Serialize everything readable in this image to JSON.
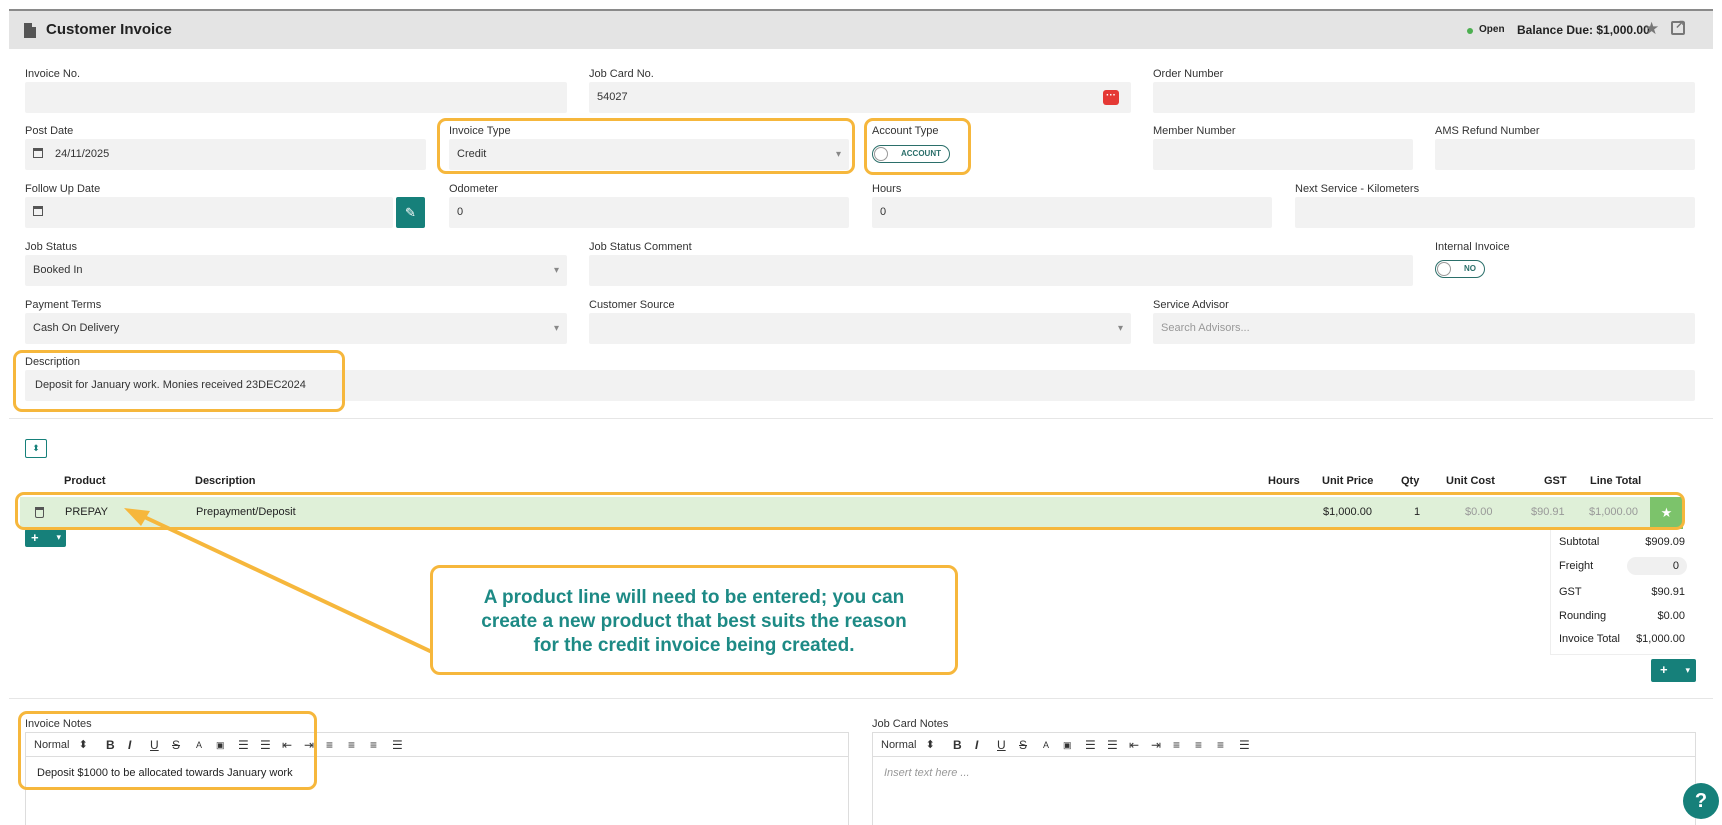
{
  "header": {
    "title": "Customer Invoice",
    "status": "Open",
    "balance": "Balance Due: $1,000.00"
  },
  "form": {
    "invoice_no": {
      "label": "Invoice No.",
      "value": ""
    },
    "job_card_no": {
      "label": "Job Card No.",
      "value": "54027"
    },
    "order_number": {
      "label": "Order Number",
      "value": ""
    },
    "post_date": {
      "label": "Post Date",
      "value": "24/11/2025"
    },
    "invoice_type": {
      "label": "Invoice Type",
      "value": "Credit"
    },
    "account_type": {
      "label": "Account Type",
      "toggle": "ACCOUNT"
    },
    "member_number": {
      "label": "Member Number",
      "value": ""
    },
    "ams_refund": {
      "label": "AMS Refund Number",
      "value": ""
    },
    "follow_up": {
      "label": "Follow Up Date",
      "value": ""
    },
    "odometer": {
      "label": "Odometer",
      "value": "0"
    },
    "hours": {
      "label": "Hours",
      "value": "0"
    },
    "next_service": {
      "label": "Next Service - Kilometers",
      "value": ""
    },
    "job_status": {
      "label": "Job Status",
      "value": "Booked In"
    },
    "job_status_comment": {
      "label": "Job Status Comment",
      "value": ""
    },
    "internal_invoice": {
      "label": "Internal Invoice",
      "toggle": "NO"
    },
    "payment_terms": {
      "label": "Payment Terms",
      "value": "Cash On Delivery"
    },
    "customer_source": {
      "label": "Customer Source",
      "value": ""
    },
    "service_advisor": {
      "label": "Service Advisor",
      "placeholder": "Search Advisors..."
    },
    "description": {
      "label": "Description",
      "value": "Deposit for January work. Monies received 23DEC2024"
    }
  },
  "lines": {
    "headers": {
      "product": "Product",
      "description": "Description",
      "hours": "Hours",
      "unit_price": "Unit Price",
      "qty": "Qty",
      "unit_cost": "Unit Cost",
      "gst": "GST",
      "line_total": "Line Total"
    },
    "rows": [
      {
        "product": "PREPAY",
        "description": "Prepayment/Deposit",
        "hours": "",
        "unit_price": "$1,000.00",
        "qty": "1",
        "unit_cost": "$0.00",
        "gst": "$90.91",
        "line_total": "$1,000.00"
      }
    ]
  },
  "totals": {
    "subtotal_label": "Subtotal",
    "subtotal": "$909.09",
    "freight_label": "Freight",
    "freight": "0",
    "gst_label": "GST",
    "gst": "$90.91",
    "rounding_label": "Rounding",
    "rounding": "$0.00",
    "total_label": "Invoice Total",
    "total": "$1,000.00"
  },
  "callout": {
    "line1": "A product line will need to be entered; you can",
    "line2": "create a new product that best suits the reason",
    "line3": "for the credit invoice being created."
  },
  "notes": {
    "invoice_label": "Invoice Notes",
    "invoice_text": "Deposit $1000 to be allocated towards January work",
    "job_card_label": "Job Card Notes",
    "job_card_placeholder": "Insert text here ...",
    "style_select": "Normal"
  },
  "colors": {
    "accent": "#16807a",
    "highlight": "#f6b73c",
    "row_bg": "#dff0d8"
  }
}
